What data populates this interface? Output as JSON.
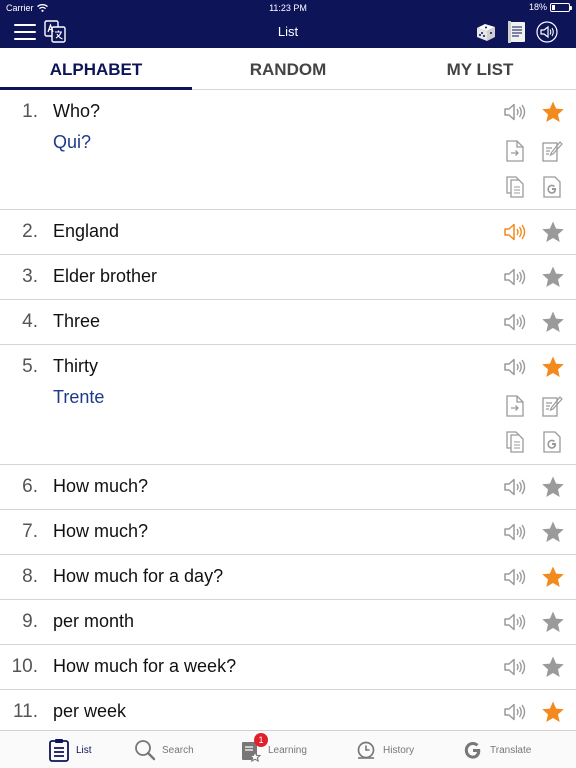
{
  "status_bar": {
    "carrier": "Carrier",
    "time": "11:23 PM",
    "battery": "18%",
    "battery_level": 0.18
  },
  "nav": {
    "title": "List",
    "icons": [
      "menu-icon",
      "translate-icon",
      "dice-icon",
      "notes-icon",
      "speaker-icon"
    ]
  },
  "tabs": [
    {
      "label": "ALPHABET",
      "active": true
    },
    {
      "label": "RANDOM",
      "active": false
    },
    {
      "label": "MY LIST",
      "active": false
    }
  ],
  "colors": {
    "primary": "#0d1458",
    "accent_orange": "#f28a1e",
    "inactive_gray": "#9a9a9a",
    "translation_blue": "#1d3a8a"
  },
  "list": [
    {
      "num": "1.",
      "term": "Who?",
      "translation": "Qui?",
      "expanded": true,
      "starred": true,
      "speaking": false
    },
    {
      "num": "2.",
      "term": "England",
      "translation": "",
      "expanded": false,
      "starred": false,
      "speaking": true
    },
    {
      "num": "3.",
      "term": "Elder brother",
      "translation": "",
      "expanded": false,
      "starred": false,
      "speaking": false
    },
    {
      "num": "4.",
      "term": "Three",
      "translation": "",
      "expanded": false,
      "starred": false,
      "speaking": false
    },
    {
      "num": "5.",
      "term": "Thirty",
      "translation": "Trente",
      "expanded": true,
      "starred": true,
      "speaking": false
    },
    {
      "num": "6.",
      "term": "How much?",
      "translation": "",
      "expanded": false,
      "starred": false,
      "speaking": false
    },
    {
      "num": "7.",
      "term": "How much?",
      "translation": "",
      "expanded": false,
      "starred": false,
      "speaking": false
    },
    {
      "num": "8.",
      "term": "How much for a day?",
      "translation": "",
      "expanded": false,
      "starred": true,
      "speaking": false
    },
    {
      "num": "9.",
      "term": "per month",
      "translation": "",
      "expanded": false,
      "starred": false,
      "speaking": false
    },
    {
      "num": "10.",
      "term": "How much for a week?",
      "translation": "",
      "expanded": false,
      "starred": false,
      "speaking": false
    },
    {
      "num": "11.",
      "term": "per week",
      "translation": "",
      "expanded": false,
      "starred": true,
      "speaking": false
    }
  ],
  "tabbar": {
    "items": [
      {
        "label": "List",
        "icon": "list-icon",
        "active": true
      },
      {
        "label": "Search",
        "icon": "search-icon",
        "active": false
      },
      {
        "label": "Learning",
        "icon": "learning-icon",
        "active": false,
        "badge": "1"
      },
      {
        "label": "History",
        "icon": "history-icon",
        "active": false
      },
      {
        "label": "Translate",
        "icon": "google-icon",
        "active": false
      }
    ]
  }
}
